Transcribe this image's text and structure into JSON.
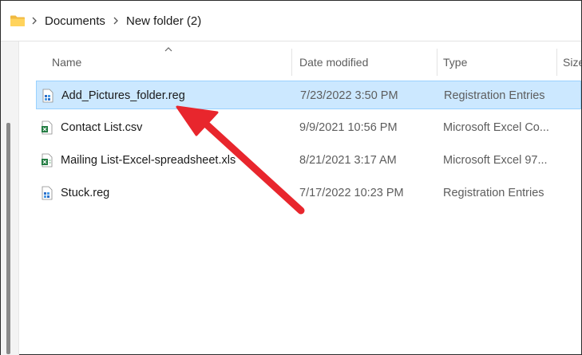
{
  "breadcrumb": {
    "items": [
      "Documents",
      "New folder (2)"
    ]
  },
  "columns": {
    "name": "Name",
    "date_modified": "Date modified",
    "type": "Type",
    "size": "Size"
  },
  "files": [
    {
      "name": "Add_Pictures_folder.reg",
      "date": "7/23/2022 3:50 PM",
      "type": "Registration Entries",
      "icon": "registry-file-icon",
      "selected": true
    },
    {
      "name": "Contact List.csv",
      "date": "9/9/2021 10:56 PM",
      "type": "Microsoft Excel Co...",
      "icon": "excel-csv-icon",
      "selected": false
    },
    {
      "name": "Mailing List-Excel-spreadsheet.xls",
      "date": "8/21/2021 3:17 AM",
      "type": "Microsoft Excel 97...",
      "icon": "excel-xls-icon",
      "selected": false
    },
    {
      "name": "Stuck.reg",
      "date": "7/17/2022 10:23 PM",
      "type": "Registration Entries",
      "icon": "registry-file-icon",
      "selected": false
    }
  ],
  "colors": {
    "selection_bg": "#cce8ff",
    "selection_border": "#99d1ff",
    "annotation_arrow": "#e8262d"
  }
}
